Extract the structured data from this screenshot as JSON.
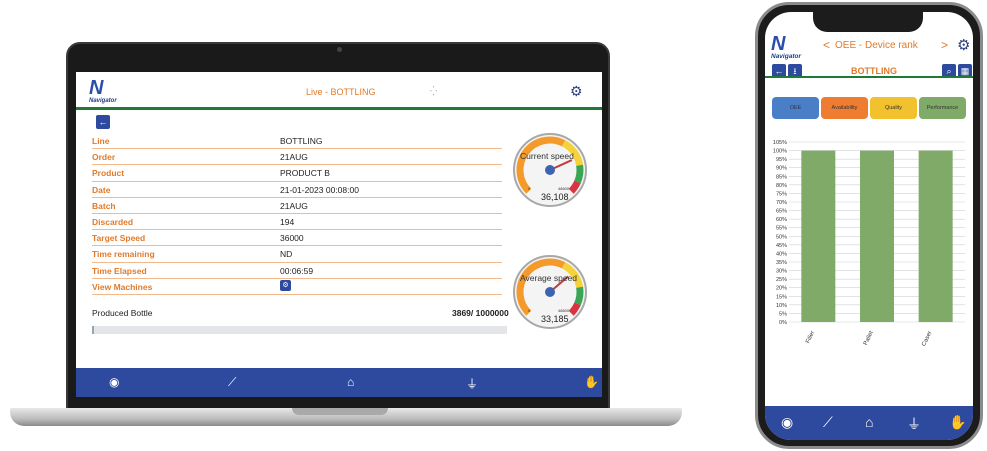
{
  "laptop": {
    "logo": {
      "mark": "N",
      "text": "Navigator"
    },
    "header": {
      "title": "Live - BOTTLING",
      "spinner": "⁛",
      "settings_icon": "gear-icon"
    },
    "back_icon": "arrow-left-icon",
    "rows": [
      {
        "label": "Line",
        "value": "BOTTLING"
      },
      {
        "label": "Order",
        "value": "21AUG"
      },
      {
        "label": "Product",
        "value": "PRODUCT B"
      },
      {
        "label": "Date",
        "value": "21-01-2023 00:08:00"
      },
      {
        "label": "Batch",
        "value": "21AUG"
      },
      {
        "label": "Discarded",
        "value": "194"
      },
      {
        "label": "Target Speed",
        "value": "36000"
      },
      {
        "label": "Time remaining",
        "value": "ND"
      },
      {
        "label": "Time Elapsed",
        "value": "00:06:59"
      },
      {
        "label": "View Machines",
        "value": ""
      }
    ],
    "produced": {
      "label": "Produced Bottle",
      "value": "3869/ 1000000",
      "progress": 0.004
    },
    "gauges": [
      {
        "label": "Current speed",
        "min": "0",
        "max": "48600",
        "value": "36,108",
        "level": 0.743
      },
      {
        "label": "Average speed",
        "min": "0",
        "max": "48600",
        "value": "33,185",
        "level": 0.683
      }
    ],
    "nav": [
      "eye-icon",
      "chart-icon",
      "home-icon",
      "plug-icon",
      "hand-icon"
    ],
    "colors": {
      "accent": "#e07a2a",
      "nav": "#2e4a9e",
      "header_line": "#1f7a35"
    }
  },
  "phone": {
    "logo": {
      "mark": "N",
      "text": "Navigator"
    },
    "title": "OEE - Device rank",
    "prev": "<",
    "next": ">",
    "subtitle": "BOTTLING",
    "tabs": [
      {
        "label": "OEE",
        "color": "#4a7fc7"
      },
      {
        "label": "Availability",
        "color": "#ee7d32"
      },
      {
        "label": "Quality",
        "color": "#f2c12e"
      },
      {
        "label": "Performance",
        "color": "#7faa68"
      }
    ],
    "nav": [
      "eye-icon",
      "chart-icon",
      "home-icon",
      "plug-icon",
      "hand-icon"
    ]
  },
  "chart_data": {
    "type": "bar",
    "categories": [
      "Filler",
      "Pallet",
      "Caser"
    ],
    "values": [
      100,
      100,
      100
    ],
    "yticks": [
      "0%",
      "5%",
      "10%",
      "15%",
      "20%",
      "25%",
      "30%",
      "35%",
      "40%",
      "45%",
      "50%",
      "55%",
      "60%",
      "65%",
      "70%",
      "75%",
      "80%",
      "85%",
      "90%",
      "95%",
      "100%",
      "105%"
    ],
    "ylim": [
      0,
      105
    ],
    "color": "#7faa68",
    "grid": true
  }
}
